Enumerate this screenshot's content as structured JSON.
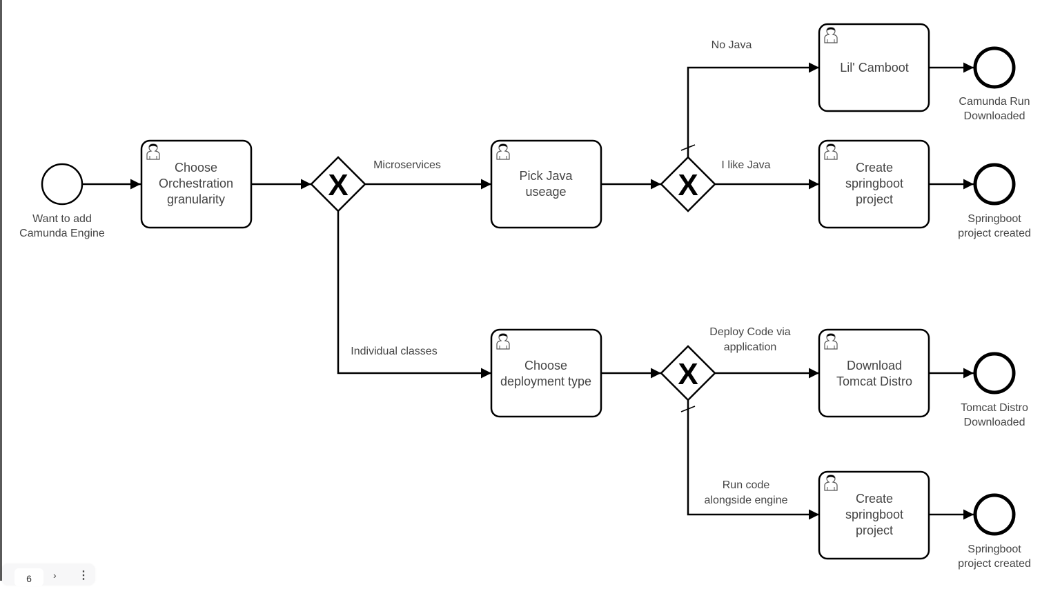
{
  "diagram": {
    "type": "BPMN process",
    "start_event": {
      "id": "start",
      "label": [
        "Want to add",
        "Camunda Engine"
      ]
    },
    "tasks": [
      {
        "id": "t_orch",
        "type": "user-task",
        "label": [
          "Choose",
          "Orchestration",
          "granularity"
        ]
      },
      {
        "id": "t_java",
        "type": "user-task",
        "label": [
          "Pick Java",
          "useage"
        ]
      },
      {
        "id": "t_deploy",
        "type": "user-task",
        "label": [
          "Choose",
          "deployment type"
        ]
      },
      {
        "id": "t_camboot",
        "type": "user-task",
        "label": [
          "Lil' Camboot"
        ]
      },
      {
        "id": "t_spring1",
        "type": "user-task",
        "label": [
          "Create",
          "springboot",
          "project"
        ]
      },
      {
        "id": "t_tomcat",
        "type": "user-task",
        "label": [
          "Download",
          "Tomcat Distro"
        ]
      },
      {
        "id": "t_spring2",
        "type": "user-task",
        "label": [
          "Create",
          "springboot",
          "project"
        ]
      }
    ],
    "gateways": [
      {
        "id": "gw1",
        "type": "exclusive",
        "marker": "X"
      },
      {
        "id": "gw2",
        "type": "exclusive",
        "marker": "X"
      },
      {
        "id": "gw3",
        "type": "exclusive",
        "marker": "X"
      }
    ],
    "end_events": [
      {
        "id": "e_run",
        "label": [
          "Camunda Run",
          "Downloaded"
        ]
      },
      {
        "id": "e_spring1",
        "label": [
          "Springboot",
          "project created"
        ]
      },
      {
        "id": "e_tomcat",
        "label": [
          "Tomcat Distro",
          "Downloaded"
        ]
      },
      {
        "id": "e_spring2",
        "label": [
          "Springboot",
          "project created"
        ]
      }
    ],
    "flows": [
      {
        "from": "start",
        "to": "t_orch",
        "label": []
      },
      {
        "from": "t_orch",
        "to": "gw1",
        "label": []
      },
      {
        "from": "gw1",
        "to": "t_java",
        "label": [
          "Microservices"
        ]
      },
      {
        "from": "gw1",
        "to": "t_deploy",
        "label": [
          "Individual classes"
        ]
      },
      {
        "from": "t_java",
        "to": "gw2",
        "label": []
      },
      {
        "from": "gw2",
        "to": "t_camboot",
        "label": [
          "No Java"
        ],
        "default": true
      },
      {
        "from": "gw2",
        "to": "t_spring1",
        "label": [
          "I like Java"
        ]
      },
      {
        "from": "t_deploy",
        "to": "gw3",
        "label": []
      },
      {
        "from": "gw3",
        "to": "t_tomcat",
        "label": [
          "Deploy Code via",
          "application"
        ]
      },
      {
        "from": "gw3",
        "to": "t_spring2",
        "label": [
          "Run code",
          "alongside engine"
        ],
        "default": true
      },
      {
        "from": "t_camboot",
        "to": "e_run",
        "label": []
      },
      {
        "from": "t_spring1",
        "to": "e_spring1",
        "label": []
      },
      {
        "from": "t_tomcat",
        "to": "e_tomcat",
        "label": []
      },
      {
        "from": "t_spring2",
        "to": "e_spring2",
        "label": []
      }
    ]
  },
  "toolbar": {
    "page_number": "6",
    "next_icon": "chevron-right-icon",
    "more_icon": "more-vertical-icon",
    "next_glyph": "›",
    "more_glyph": "⋮"
  }
}
